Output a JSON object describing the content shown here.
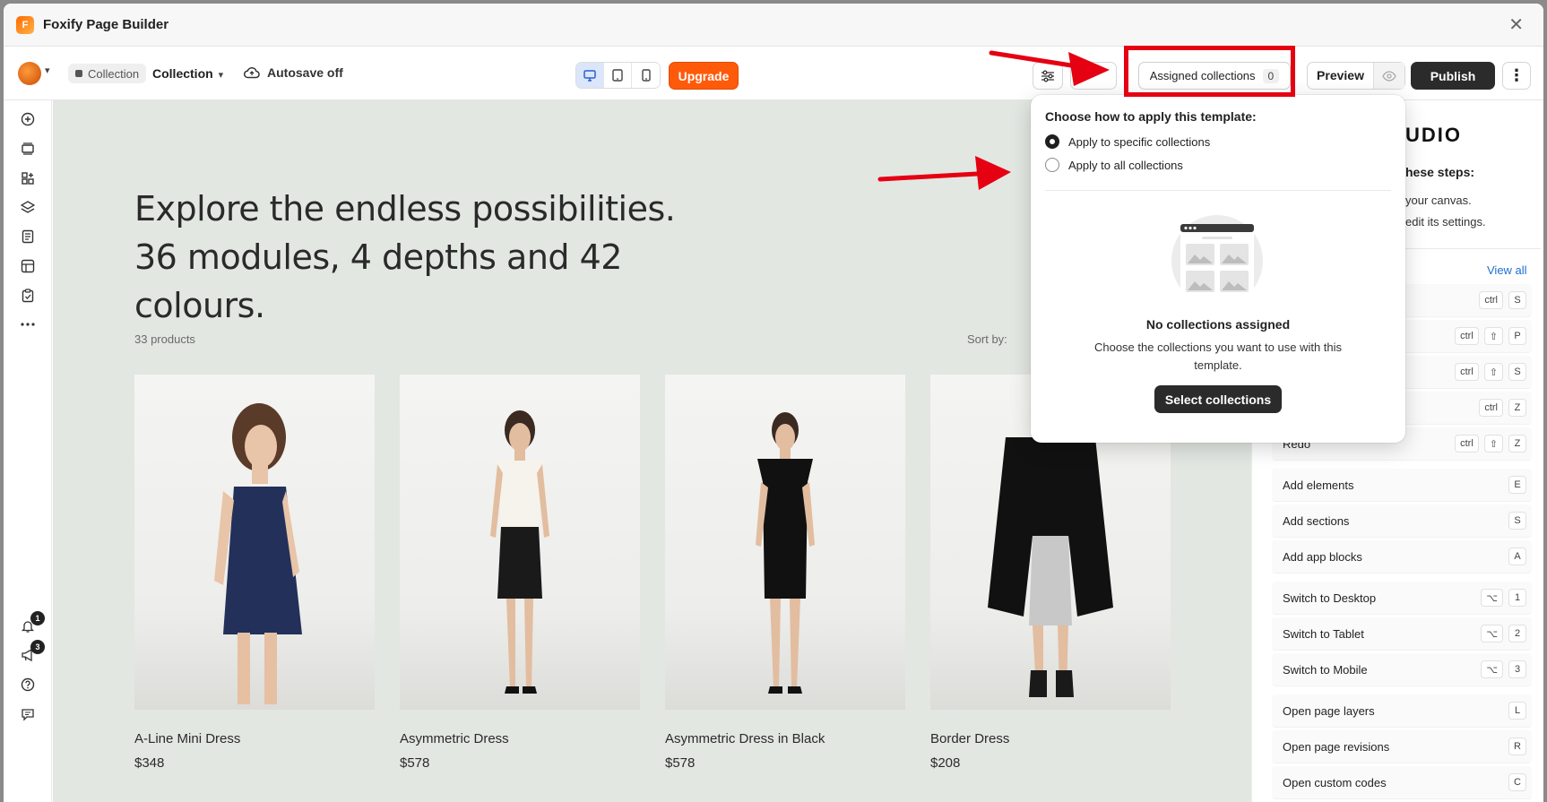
{
  "window": {
    "title": "Foxify Page Builder",
    "logo_glyph": "F"
  },
  "toolbar": {
    "page_type_pill": "Collection",
    "template_name": "Collection",
    "autosave": "Autosave off",
    "upgrade": "Upgrade",
    "assigned_collections": "Assigned collections",
    "assigned_count": "0",
    "preview": "Preview",
    "publish": "Publish",
    "more": "⋮",
    "accent_color": "#ff5a0a"
  },
  "canvas": {
    "hero_title": "Explore the endless possibilities. 36 modules, 4 depths and 42 colours.",
    "product_count": "33 products",
    "sort_label": "Sort by:",
    "products": [
      {
        "name": "A-Line Mini Dress",
        "price": "$348"
      },
      {
        "name": "Asymmetric Dress",
        "price": "$578"
      },
      {
        "name": "Asymmetric Dress in Black",
        "price": "$578"
      },
      {
        "name": "Border Dress",
        "price": "$208"
      }
    ]
  },
  "left_rail": {
    "notifications_badge": "1",
    "announcements_badge": "3"
  },
  "right_panel": {
    "logo_text": "UDIO",
    "steps_heading": "hese steps:",
    "line1": "your canvas.",
    "line2": "edit its settings.",
    "view_all": "View all",
    "shortcuts": [
      {
        "label": "",
        "keys": [
          "ctrl",
          "S"
        ]
      },
      {
        "label": "",
        "keys": [
          "ctrl",
          "⇧",
          "P"
        ]
      },
      {
        "label": "",
        "keys": [
          "ctrl",
          "⇧",
          "S"
        ]
      },
      {
        "label": "",
        "keys": [
          "ctrl",
          "Z"
        ]
      },
      {
        "label": "Redo",
        "keys": [
          "ctrl",
          "⇧",
          "Z"
        ]
      },
      {
        "label": "Add elements",
        "keys": [
          "E"
        ]
      },
      {
        "label": "Add sections",
        "keys": [
          "S"
        ]
      },
      {
        "label": "Add app blocks",
        "keys": [
          "A"
        ]
      },
      {
        "label": "Switch to Desktop",
        "keys": [
          "⌥",
          "1"
        ]
      },
      {
        "label": "Switch to Tablet",
        "keys": [
          "⌥",
          "2"
        ]
      },
      {
        "label": "Switch to Mobile",
        "keys": [
          "⌥",
          "3"
        ]
      },
      {
        "label": "Open page layers",
        "keys": [
          "L"
        ]
      },
      {
        "label": "Open page revisions",
        "keys": [
          "R"
        ]
      },
      {
        "label": "Open custom codes",
        "keys": [
          "C"
        ]
      }
    ]
  },
  "popover": {
    "heading": "Choose how to apply this template:",
    "option_specific": "Apply to specific collections",
    "option_all": "Apply to all collections",
    "selected_option": "specific",
    "empty_title": "No collections assigned",
    "empty_desc": "Choose the collections you want to use with this template.",
    "select_button": "Select collections"
  },
  "annotation": {
    "highlight_color": "#e50012"
  }
}
